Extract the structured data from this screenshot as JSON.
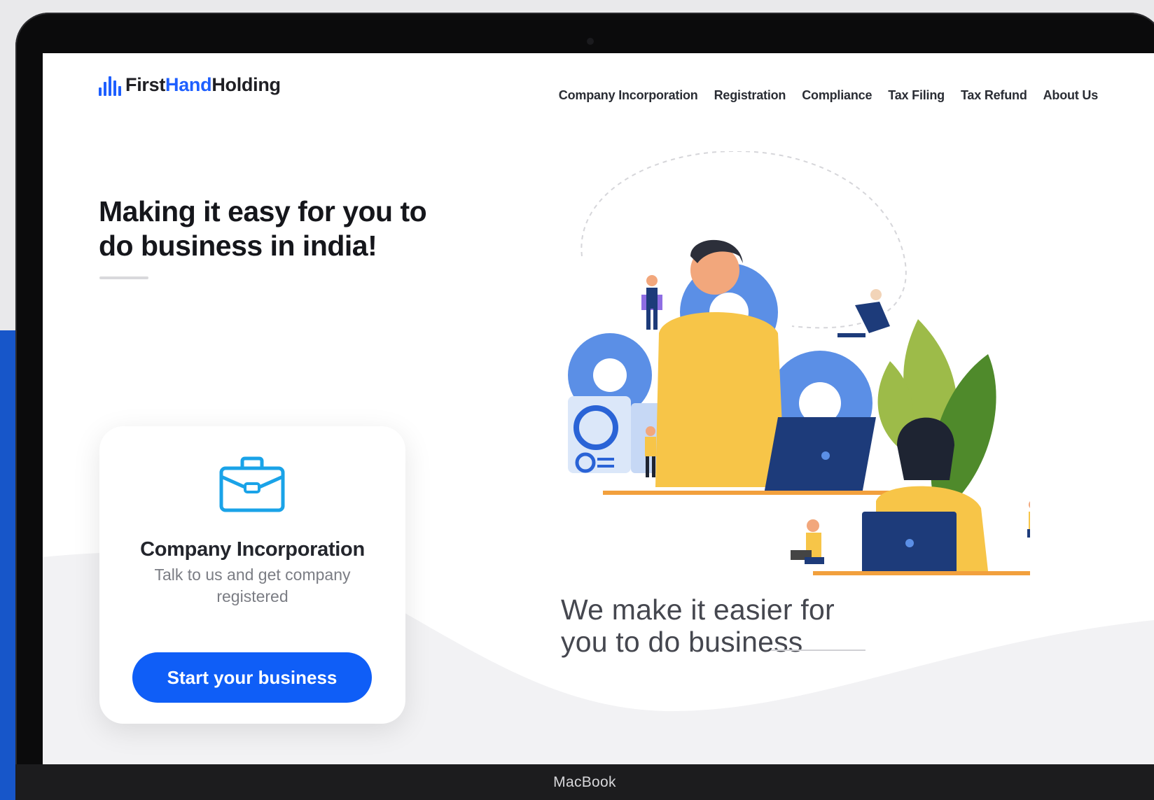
{
  "site": {
    "logo": {
      "part1": "First",
      "part2": "Hand",
      "part3": "Holding"
    },
    "nav": [
      "Company Incorporation",
      "Registration",
      "Compliance",
      "Tax Filing",
      "Tax Refund",
      "About Us"
    ]
  },
  "hero": {
    "headline": "Making it easy for you to do business in india!",
    "tagline": "We make it easier for you to do business"
  },
  "card": {
    "icon": "briefcase-icon",
    "title": "Company Incorporation",
    "subtitle": "Talk to us and get company registered",
    "button_label": "Start your business"
  },
  "device": {
    "label": "MacBook"
  },
  "colors": {
    "accent": "#0f5ef7",
    "logo_blue": "#1e5fff",
    "headline": "#15161b",
    "illustration_yellow": "#f7c548",
    "illustration_navy": "#1d3b7a",
    "illustration_gear": "#5b8fe6",
    "illustration_leaf": "#4f8a2b"
  }
}
